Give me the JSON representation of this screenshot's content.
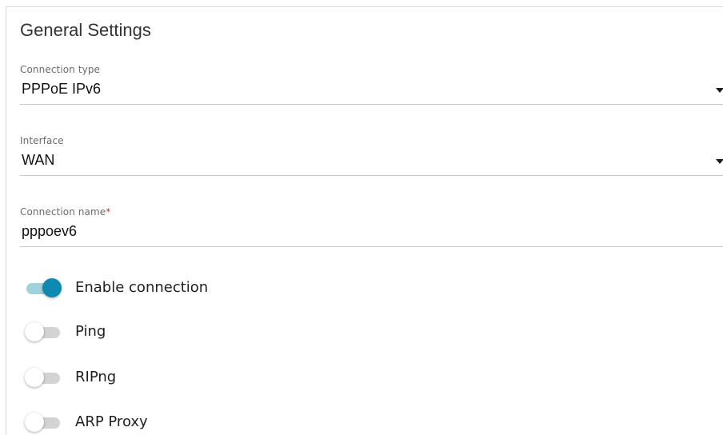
{
  "section": {
    "title": "General Settings"
  },
  "fields": {
    "connection_type": {
      "label": "Connection type",
      "value": "PPPoE IPv6",
      "icon": "chevron-down-icon"
    },
    "interface": {
      "label": "Interface",
      "value": "WAN",
      "icon": "chevron-down-icon"
    },
    "connection_name": {
      "label": "Connection name",
      "required_mark": "*",
      "value": "pppoev6"
    }
  },
  "toggles": [
    {
      "label": "Enable connection",
      "state": true
    },
    {
      "label": "Ping",
      "state": false
    },
    {
      "label": "RIPng",
      "state": false
    },
    {
      "label": "ARP Proxy",
      "state": false
    }
  ],
  "colors": {
    "accent": "#0e8ab0",
    "accent_track": "#9ed2dd",
    "required": "#d9272e"
  }
}
